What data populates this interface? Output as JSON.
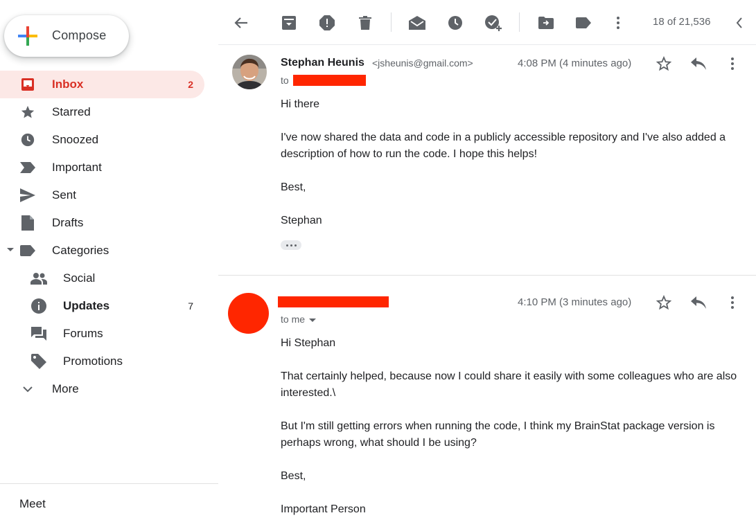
{
  "compose": {
    "label": "Compose"
  },
  "sidebar": {
    "items": [
      {
        "label": "Inbox",
        "count": "2",
        "icon": "inbox-icon"
      },
      {
        "label": "Starred",
        "count": "",
        "icon": "star-icon"
      },
      {
        "label": "Snoozed",
        "count": "",
        "icon": "clock-icon"
      },
      {
        "label": "Important",
        "count": "",
        "icon": "important-icon"
      },
      {
        "label": "Sent",
        "count": "",
        "icon": "send-icon"
      },
      {
        "label": "Drafts",
        "count": "",
        "icon": "draft-icon"
      },
      {
        "label": "Categories",
        "count": "",
        "icon": "label-icon"
      },
      {
        "label": "Social",
        "count": "",
        "icon": "people-icon"
      },
      {
        "label": "Updates",
        "count": "7",
        "icon": "info-icon"
      },
      {
        "label": "Forums",
        "count": "",
        "icon": "forum-icon"
      },
      {
        "label": "Promotions",
        "count": "",
        "icon": "tag-icon"
      },
      {
        "label": "More",
        "count": "",
        "icon": "chevron-down-icon"
      }
    ],
    "meet_label": "Meet"
  },
  "toolbar": {
    "pager": "18 of 21,536",
    "icons": [
      "back-arrow-icon",
      "archive-icon",
      "report-spam-icon",
      "delete-icon",
      "mark-unread-icon",
      "snooze-icon",
      "add-task-icon",
      "move-to-icon",
      "labels-icon",
      "more-vert-icon",
      "chevron-left-icon"
    ]
  },
  "messages": [
    {
      "sender": "Stephan Heunis",
      "email": "<jsheunis@gmail.com>",
      "to_prefix": "to",
      "time": "4:08 PM (4 minutes ago)",
      "body": [
        "Hi there",
        "I've now shared the data and code in a publicly accessible repository and I've also added a description of how to run the code. I hope this helps!",
        "Best,",
        "Stephan"
      ]
    },
    {
      "to_me": "to me",
      "time": "4:10 PM (3 minutes ago)",
      "body": [
        "Hi Stephan",
        "That certainly helped, because now I could share it easily with some colleagues who are also interested.\\",
        "But I'm still getting errors when running the code, I think my BrainStat package version is perhaps wrong, what should I be using?",
        "Best,",
        "Important Person"
      ]
    }
  ],
  "colors": {
    "accent_red": "#d93025",
    "active_bg": "#fce8e6",
    "redaction": "#ff2600",
    "icon_grey": "#5f6368"
  }
}
